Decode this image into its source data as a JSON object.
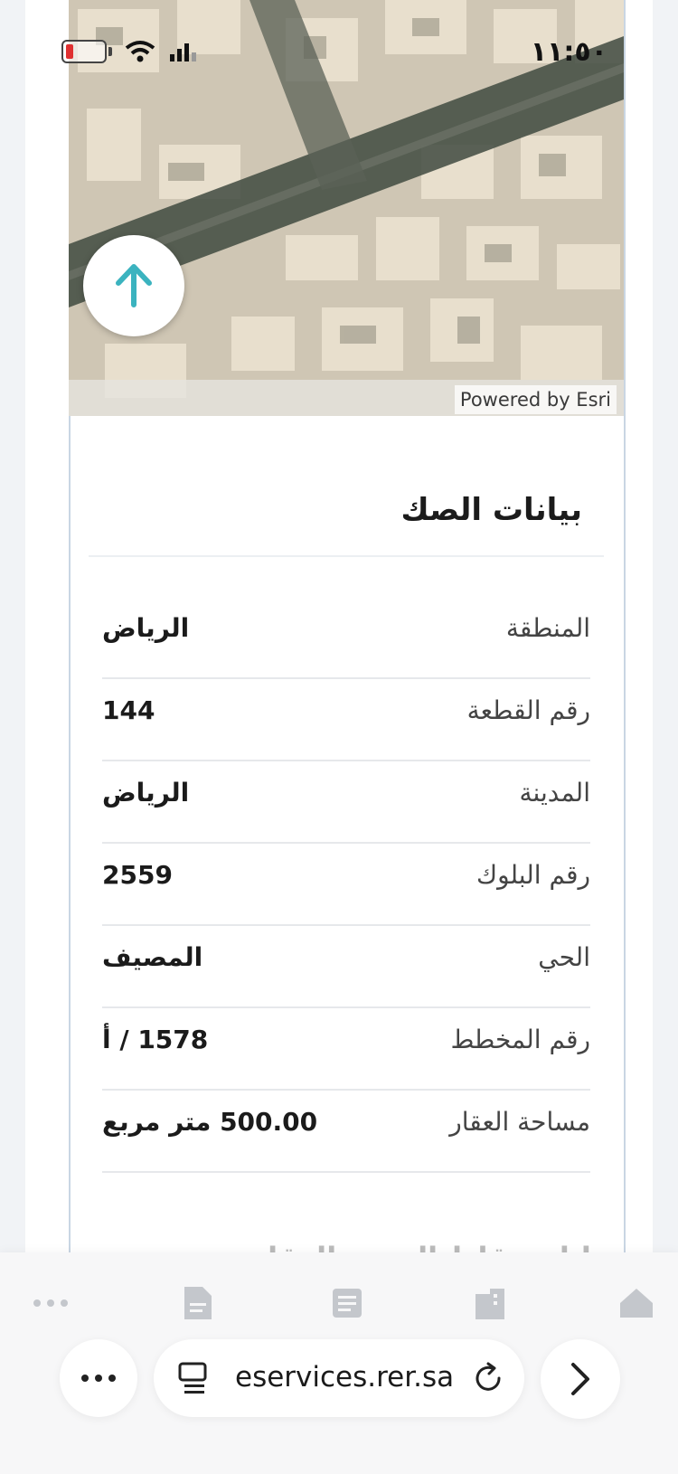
{
  "status_bar": {
    "time": "١١:٥٠"
  },
  "map": {
    "attribution": "Powered by Esri"
  },
  "deed": {
    "title": "بيانات الصك",
    "rows": [
      {
        "label": "المنطقة",
        "value": "الرياض"
      },
      {
        "label": "رقم القطعة",
        "value": "144"
      },
      {
        "label": "المدينة",
        "value": "الرياض"
      },
      {
        "label": "رقم البلوك",
        "value": "2559"
      },
      {
        "label": "الحي",
        "value": "المصيف"
      },
      {
        "label": "رقم المخطط",
        "value": "1578 / أ"
      },
      {
        "label": "مساحة العقار",
        "value": "500.00 متر مربع"
      }
    ]
  },
  "next_section_title": "بيانات نقاط الحدود العقار",
  "browser": {
    "url": "eservices.rer.sa"
  },
  "colors": {
    "accent": "#3bb3bf",
    "text": "#1b1b1b"
  }
}
